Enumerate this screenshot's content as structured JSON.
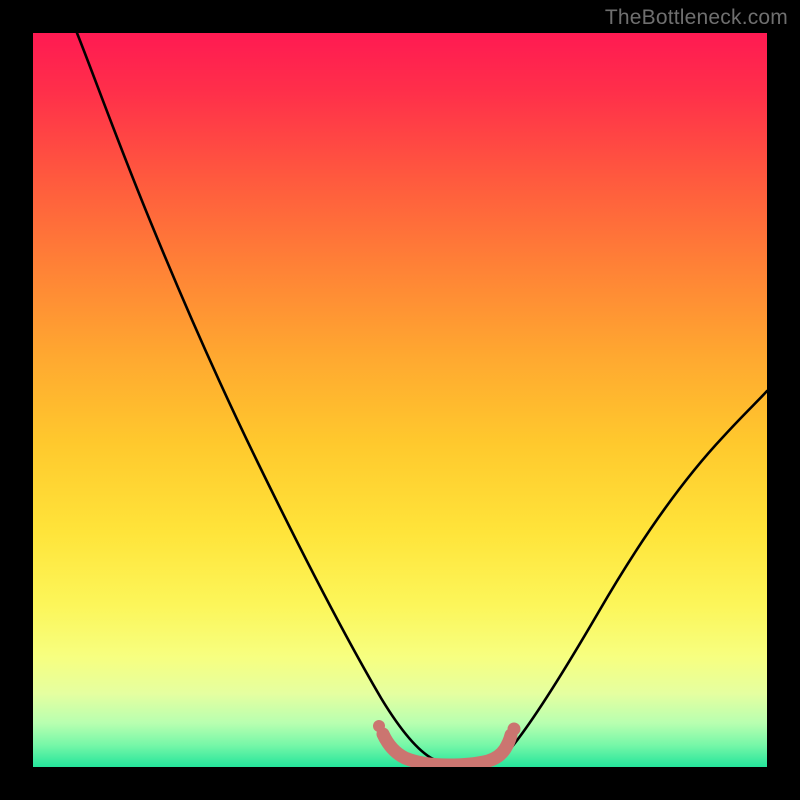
{
  "watermark_text": "TheBottleneck.com",
  "colors": {
    "page_bg": "#000000",
    "curve": "#000000",
    "marker": "#cb7570",
    "gradient_top": "#ff1a52",
    "gradient_bottom": "#24e59b"
  },
  "chart_data": {
    "type": "line",
    "title": "",
    "xlabel": "",
    "ylabel": "",
    "xlim": [
      0,
      100
    ],
    "ylim": [
      0,
      100
    ],
    "grid": false,
    "legend": false,
    "series": [
      {
        "name": "curve",
        "x": [
          6,
          10,
          15,
          20,
          25,
          30,
          35,
          40,
          45,
          48,
          50,
          52,
          54,
          56,
          58,
          60,
          65,
          70,
          75,
          80,
          85,
          90,
          95,
          100
        ],
        "y": [
          100,
          91,
          80,
          70,
          60,
          50,
          41,
          31,
          20,
          12,
          7,
          3,
          1,
          0,
          0,
          0,
          2,
          8,
          15,
          23,
          32,
          41,
          48,
          54
        ]
      },
      {
        "name": "bottom-markers",
        "x": [
          48,
          50,
          52,
          54,
          56,
          58,
          60,
          62,
          63
        ],
        "y": [
          4,
          2.2,
          1.2,
          0.7,
          0.6,
          0.6,
          0.7,
          1.2,
          2.5
        ]
      }
    ],
    "annotations": []
  }
}
